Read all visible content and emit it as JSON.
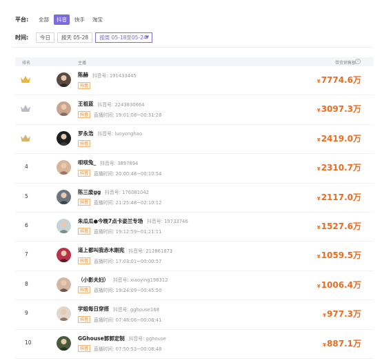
{
  "filters": {
    "platform_label": "平台:",
    "platforms": [
      {
        "label": "全部",
        "active": false
      },
      {
        "label": "抖音",
        "active": true
      },
      {
        "label": "快手",
        "active": false
      },
      {
        "label": "淘宝",
        "active": false
      }
    ],
    "time_label": "时间:",
    "today": "今日",
    "by_day": "按天 05-28",
    "by_week": "按周 05-18至05-24"
  },
  "table": {
    "col_rank": "排名",
    "col_anchor": "主播",
    "col_sales": "带货销售额",
    "info_icon": "i"
  },
  "rows": [
    {
      "rank": "",
      "medal": "gold",
      "name": "陈赫",
      "douyin_id": "抖音号: 191433445",
      "tag": "抖音",
      "live_time": "",
      "sales": "7774.6万"
    },
    {
      "rank": "",
      "medal": "silver",
      "name": "王祖蓝",
      "douyin_id": "抖音号: 2243830664",
      "tag": "抖音",
      "live_time": "直播时间: 19:01:08~00:31:28",
      "sales": "3097.3万"
    },
    {
      "rank": "",
      "medal": "bronze",
      "name": "罗永浩",
      "douyin_id": "抖音号: luoyonghao",
      "tag": "抖音",
      "live_time": "",
      "sales": "2419.0万"
    },
    {
      "rank": "4",
      "medal": "",
      "name": "呗呗兔_",
      "douyin_id": "抖音号: 3897894",
      "tag": "抖音",
      "live_time": "直播时间: 20:00:48~00:10:54",
      "sales": "2310.7万"
    },
    {
      "rank": "5",
      "medal": "",
      "name": "陈三废gg",
      "douyin_id": "抖音号: 176081042",
      "tag": "抖音",
      "live_time": "直播时间: 21:25:48~02:10:12",
      "sales": "2117.0万"
    },
    {
      "rank": "6",
      "medal": "",
      "name": "朱瓜瓜●今晚7点卡姿兰专场",
      "douyin_id": "抖音号: 19733746",
      "tag": "抖音",
      "live_time": "直播时间: 19:12:59~01:21:11",
      "sales": "1527.6万"
    },
    {
      "rank": "7",
      "medal": "",
      "name": "道上都叫我赤木刚宪",
      "douyin_id": "抖音号: 212861873",
      "tag": "抖音",
      "live_time": "直播时间: 17:03:01~00:00:57",
      "sales": "1059.5万"
    },
    {
      "rank": "8",
      "medal": "",
      "name": "（小影夫妇）",
      "douyin_id": "抖音号: xiaoying198312",
      "tag": "抖音",
      "live_time": "直播时间: 19:24:09~00:45:50",
      "sales": "1006.4万"
    },
    {
      "rank": "9",
      "medal": "",
      "name": "学姐每日穿搭",
      "douyin_id": "抖音号: gghouse168",
      "tag": "抖音",
      "live_time": "直播时间: 07:48:06~00:08:41",
      "sales": "977.3万"
    },
    {
      "rank": "10",
      "medal": "",
      "name": "GGhouse郭郭定制",
      "douyin_id": "抖音号: gghouse",
      "tag": "抖音",
      "live_time": "直播时间: 07:50:53~00:08:48",
      "sales": "887.1万"
    }
  ],
  "currency_symbol": "¥",
  "dropdown_caret": "▼",
  "colors": {
    "accent": "#7b6cd9",
    "sales": "#ee6b1e",
    "gold": "#e8b83a",
    "silver": "#b9bcc4",
    "bronze": "#d6b46a"
  }
}
